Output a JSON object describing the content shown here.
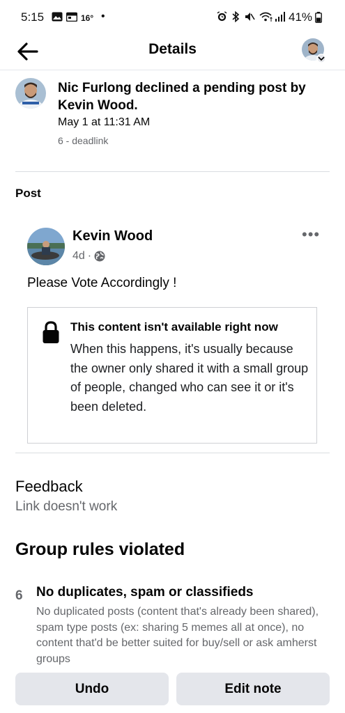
{
  "status_bar": {
    "time": "5:15",
    "temperature": "16°",
    "battery": "41%"
  },
  "header": {
    "title": "Details"
  },
  "activity": {
    "text": "Nic Furlong declined a pending post by Kevin Wood.",
    "time": "May 1 at 11:31 AM",
    "subtitle": "6 - deadlink"
  },
  "post_section": {
    "label": "Post",
    "author": "Kevin Wood",
    "age": "4d",
    "meta_separator": "·",
    "text": "Please Vote Accordingly  !",
    "unavailable": {
      "title": "This content isn't available right now",
      "body": "When this happens, it's usually because the owner only shared it with a small group of people, changed who can see it or it's been deleted."
    }
  },
  "feedback": {
    "title": "Feedback",
    "value": "Link doesn't work"
  },
  "rules": {
    "title": "Group rules violated",
    "items": [
      {
        "number": "6",
        "title": "No duplicates, spam or classifieds",
        "description": "No duplicated posts (content that's already been shared), spam type posts (ex: sharing 5 memes all at once), no content that'd be better suited for buy/sell or ask amherst groups"
      }
    ]
  },
  "actions": {
    "undo_label": "Undo",
    "edit_note_label": "Edit note"
  },
  "colors": {
    "text_primary": "#050505",
    "text_secondary": "#65676b",
    "button_bg": "#e4e6eb",
    "divider": "#dadde1"
  }
}
